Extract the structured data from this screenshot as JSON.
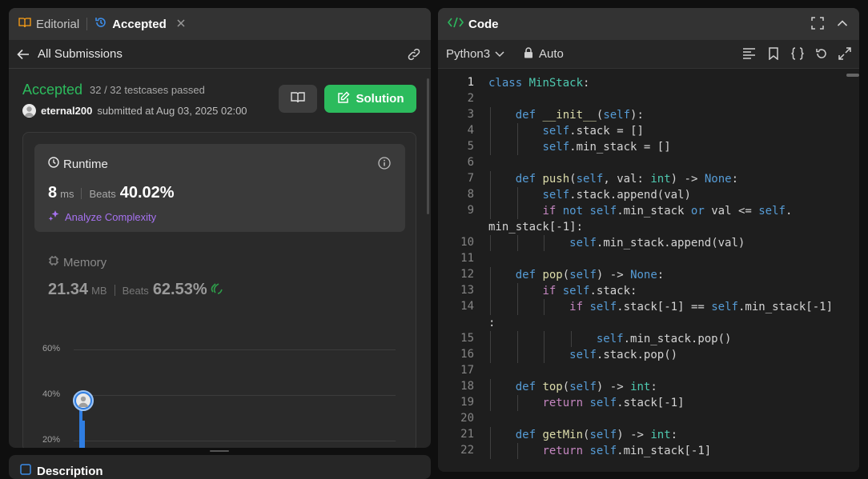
{
  "left_panel": {
    "tabs": [
      {
        "label": "Editorial"
      },
      {
        "label": "Accepted"
      }
    ],
    "back_label": "All Submissions",
    "result": {
      "status": "Accepted",
      "testcases": "32 / 32 testcases passed",
      "username": "eternal200",
      "submitted_text": "submitted at Aug 03, 2025 02:00",
      "solution_button": "Solution"
    },
    "runtime": {
      "label": "Runtime",
      "value": "8",
      "unit": "ms",
      "beats_label": "Beats",
      "beats_value": "40.02%",
      "analyze_label": "Analyze Complexity"
    },
    "memory": {
      "label": "Memory",
      "value": "21.34",
      "unit": "MB",
      "beats_label": "Beats",
      "beats_value": "62.53%"
    },
    "chart_data": {
      "type": "bar",
      "yticks": [
        "60%",
        "40%",
        "20%"
      ]
    },
    "bottom_tab": "Description"
  },
  "right_panel": {
    "title": "Code",
    "language": "Python3",
    "mode": "Auto",
    "code_lines": [
      "class MinStack:",
      "",
      "    def __init__(self):",
      "        self.stack = []",
      "        self.min_stack = []",
      "",
      "    def push(self, val: int) -> None:",
      "        self.stack.append(val)",
      "        if not self.min_stack or val <= self.",
      "min_stack[-1]:",
      "            self.min_stack.append(val)",
      "",
      "    def pop(self) -> None:",
      "        if self.stack:",
      "            if self.stack[-1] == self.min_stack[-1]",
      ":",
      "                self.min_stack.pop()",
      "            self.stack.pop()",
      "",
      "    def top(self) -> int:",
      "        return self.stack[-1]",
      "",
      "    def getMin(self) -> int:",
      "        return self.min_stack[-1]"
    ],
    "line_numbers": [
      "1",
      "2",
      "3",
      "4",
      "5",
      "6",
      "7",
      "8",
      "9",
      "",
      "10",
      "11",
      "12",
      "13",
      "14",
      "",
      "15",
      "16",
      "17",
      "18",
      "19",
      "20",
      "21",
      "22"
    ]
  },
  "colors": {
    "accent_green": "#2cbb5d",
    "analyze_purple": "#a672f0",
    "chart_blue": "#2f7de1"
  }
}
